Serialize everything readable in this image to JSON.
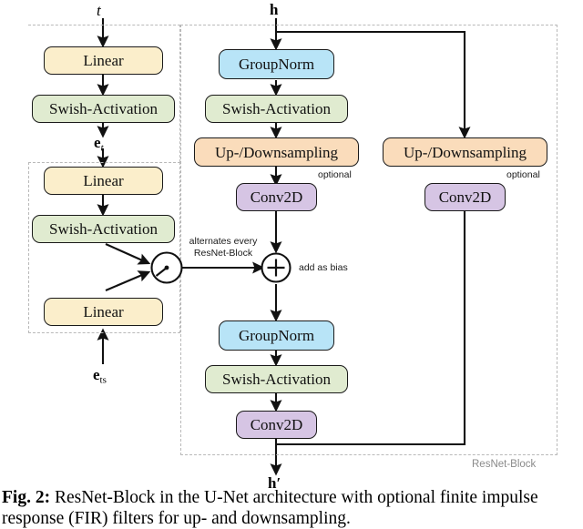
{
  "figure": {
    "caption_label": "Fig. 2:",
    "caption_text": " ResNet-Block in the U-Net architecture with optional finite impulse response (FIR) filters for up- and downsampling."
  },
  "io_labels": {
    "t": "t",
    "h": "h",
    "e_t_base": "e",
    "e_t_sub": "t",
    "e_ts_base": "e",
    "e_ts_sub": "ts",
    "h_out": "h′"
  },
  "left_branch": {
    "linear_1": "Linear",
    "swish_1": "Swish-Activation",
    "linear_2": "Linear",
    "swish_2": "Swish-Activation",
    "linear_3": "Linear"
  },
  "main_branch": {
    "groupnorm_1": "GroupNorm",
    "swish_1": "Swish-Activation",
    "updown_1": "Up-/Downsampling",
    "updown_1_note": "optional",
    "conv_1": "Conv2D",
    "groupnorm_2": "GroupNorm",
    "swish_2": "Swish-Activation",
    "conv_2": "Conv2D"
  },
  "skip_branch": {
    "updown": "Up-/Downsampling",
    "updown_note": "optional",
    "conv": "Conv2D"
  },
  "operators": {
    "switch_note_line1": "alternates every",
    "switch_note_line2": "ResNet-Block",
    "switch_name": "switch",
    "add_symbol": "+",
    "add_note": "add as bias"
  },
  "block_label": "ResNet-Block",
  "colors": {
    "linear": "#fbeecb",
    "swish": "#e0ebd0",
    "groupnorm": "#b8e4f7",
    "updown": "#fadcbb",
    "conv2d": "#d6c5e4",
    "stroke": "#1a1a1a",
    "dashed": "#b9b9b9",
    "block_label": "#8a8a8a"
  }
}
